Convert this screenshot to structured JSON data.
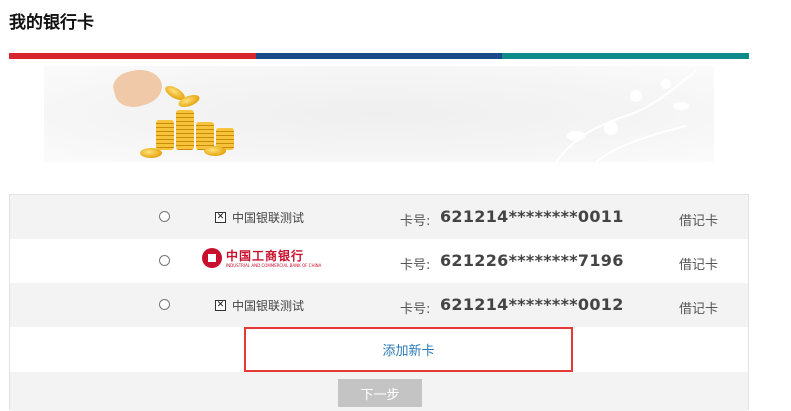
{
  "page": {
    "title": "我的银行卡"
  },
  "theme": {
    "bar_colors": [
      "#d8262e",
      "#1b4a8a",
      "#0e8a8a"
    ],
    "highlight_border": "#e53935",
    "link_color": "#2a7ab8",
    "button_disabled_bg": "#c4c4c4"
  },
  "banner": {
    "icon": "coins-banner-image"
  },
  "cards": [
    {
      "bank_icon": "broken-image-icon",
      "bank_name": "中国银联测试",
      "label": "卡号:",
      "number": "621214********0011",
      "type": "借记卡",
      "selected": false
    },
    {
      "bank_icon": "icbc-logo",
      "bank_name": "中国工商银行",
      "bank_name_en": "INDUSTRIAL AND COMMERCIAL BANK OF CHINA",
      "label": "卡号:",
      "number": "621226********7196",
      "type": "借记卡",
      "selected": false
    },
    {
      "bank_icon": "broken-image-icon",
      "bank_name": "中国银联测试",
      "label": "卡号:",
      "number": "621214********0012",
      "type": "借记卡",
      "selected": false
    }
  ],
  "actions": {
    "add_card_label": "添加新卡",
    "next_label": "下一步"
  }
}
